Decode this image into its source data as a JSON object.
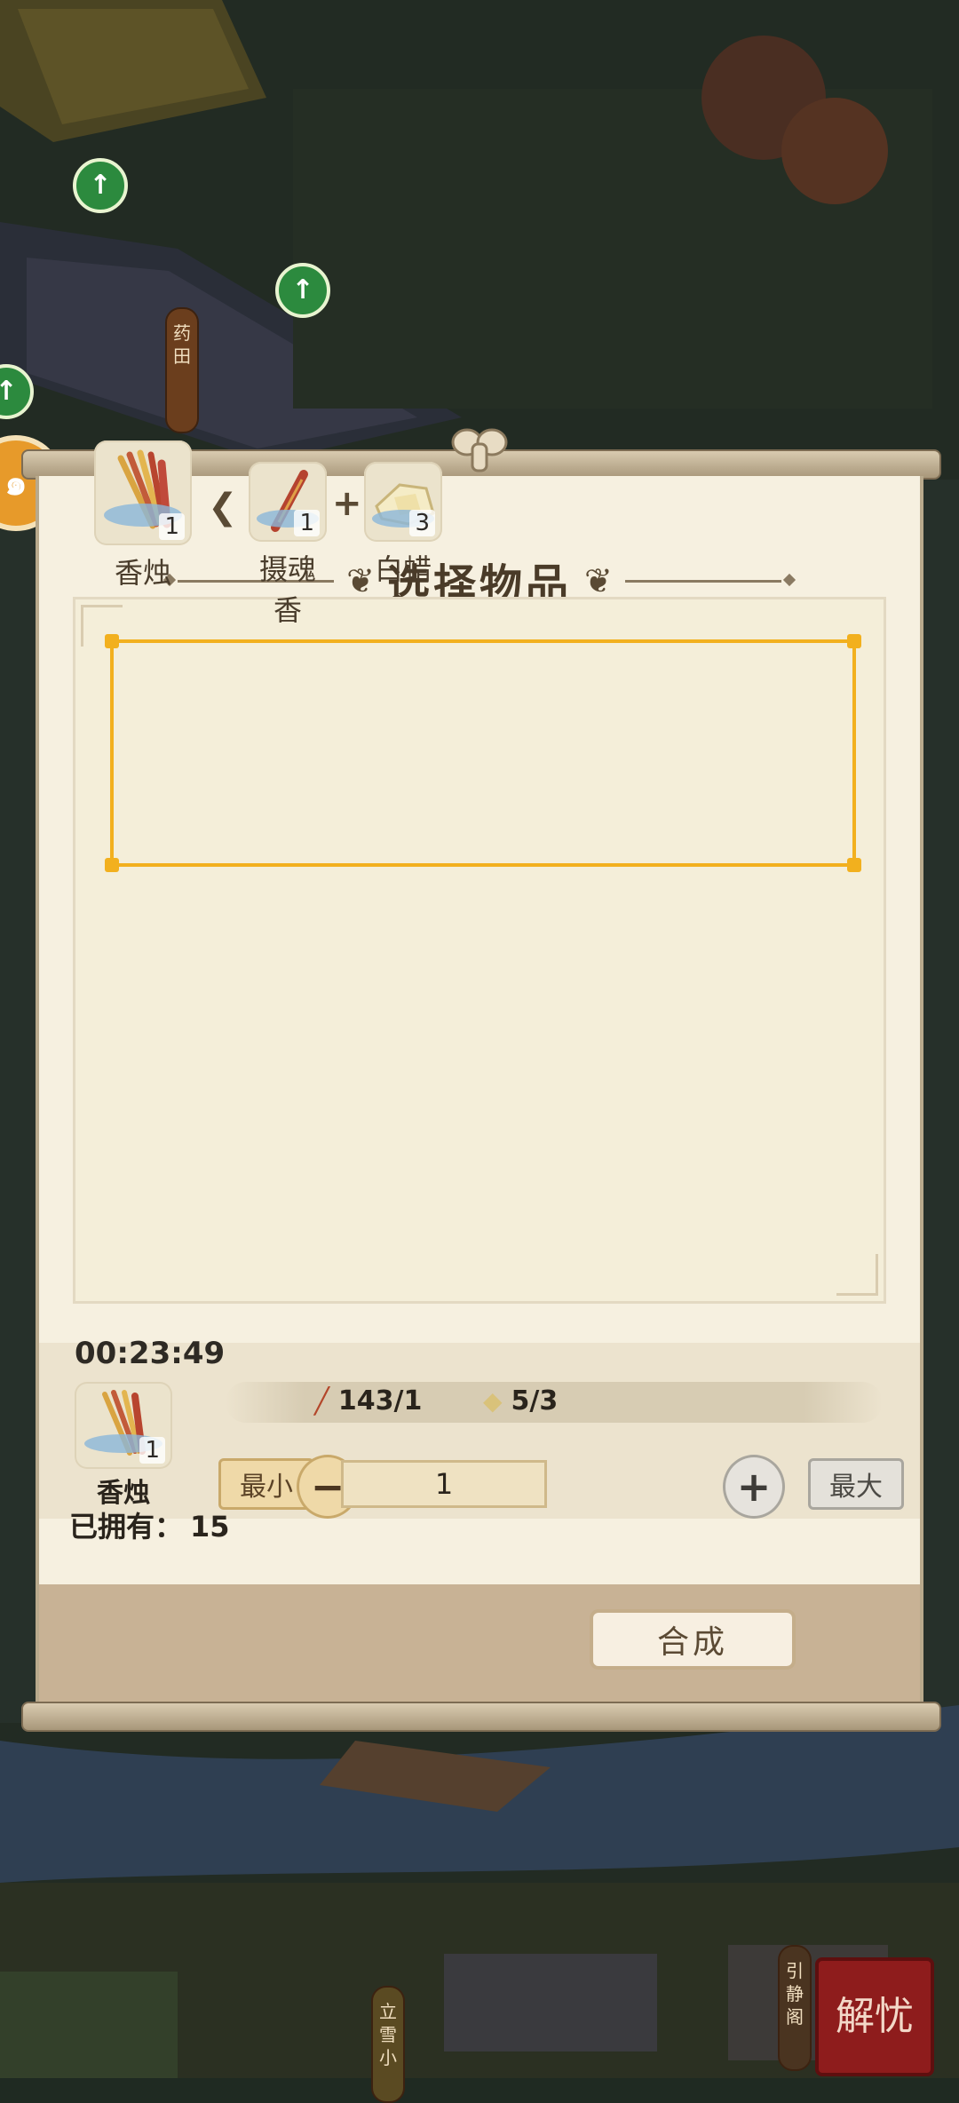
{
  "map": {
    "sign_yaotian": "药田",
    "sign_yinjing": "引静阁",
    "sign_lixue": "立雪小",
    "seal_text": "解忧",
    "side_badge_icon": "spiral-icon"
  },
  "dialog": {
    "title": "选择物品",
    "recipe": {
      "result": {
        "name": "香烛",
        "qty": "1",
        "icon": "incense-candles-icon"
      },
      "ingredients": [
        {
          "name": "摄魂香",
          "qty": "1",
          "icon": "incense-stick-icon"
        },
        {
          "name": "白蜡",
          "qty": "3",
          "icon": "white-wax-icon"
        }
      ]
    },
    "timer": "00:23:49",
    "selected": {
      "name": "香烛",
      "qty": "1"
    },
    "owned_label": "已拥有：",
    "owned_value": "15",
    "materials": [
      {
        "icon": "incense-stick-icon",
        "value": "143/1"
      },
      {
        "icon": "white-wax-icon",
        "value": "5/3"
      }
    ],
    "min_label": "最小",
    "max_label": "最大",
    "quantity": "1",
    "craft_label": "合成"
  }
}
